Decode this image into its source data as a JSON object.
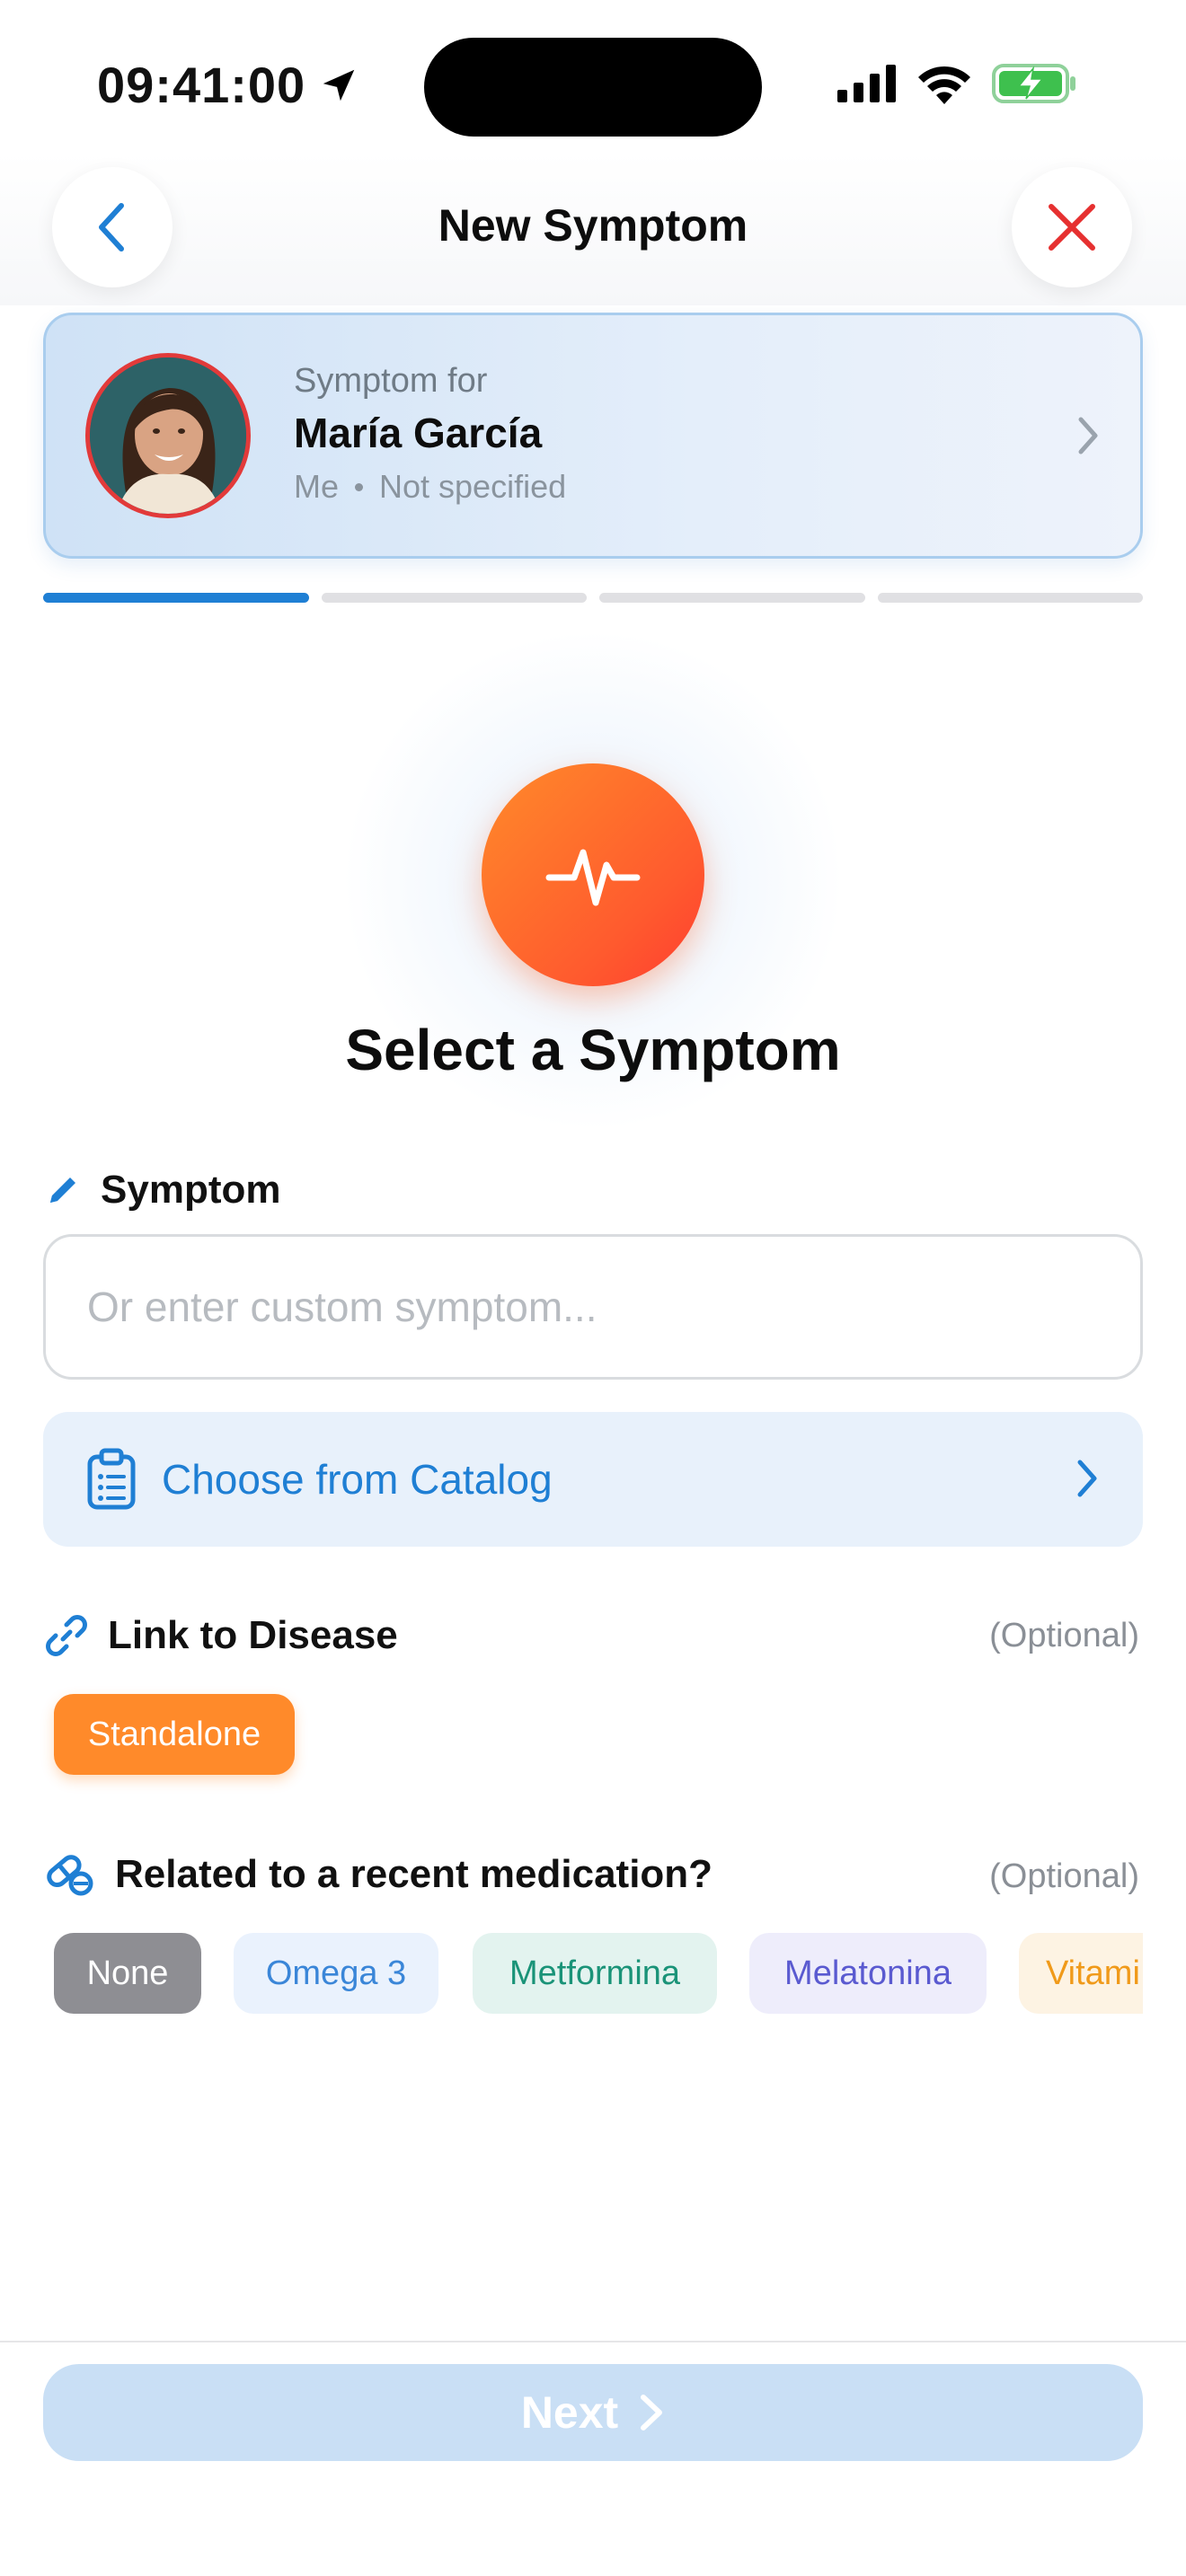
{
  "status_bar": {
    "time": "09:41:00"
  },
  "header": {
    "title": "New Symptom"
  },
  "patient": {
    "label": "Symptom for",
    "name": "María García",
    "relation": "Me",
    "detail": "Not specified"
  },
  "progress": {
    "current_step": 1,
    "total_steps": 4
  },
  "hero": {
    "title": "Select a Symptom"
  },
  "symptom": {
    "label": "Symptom",
    "placeholder": "Or enter custom symptom...",
    "value": ""
  },
  "catalog": {
    "label": "Choose from Catalog"
  },
  "disease": {
    "label": "Link to Disease",
    "optional": "(Optional)",
    "selected": "Standalone"
  },
  "medication": {
    "label": "Related to a recent medication?",
    "optional": "(Optional)",
    "options": [
      "None",
      "Omega 3",
      "Metformina",
      "Melatonina",
      "Vitami"
    ]
  },
  "footer": {
    "next_label": "Next"
  },
  "colors": {
    "accent": "#1f7fd4",
    "orange": "#ff8a2a",
    "close": "#e63030"
  }
}
